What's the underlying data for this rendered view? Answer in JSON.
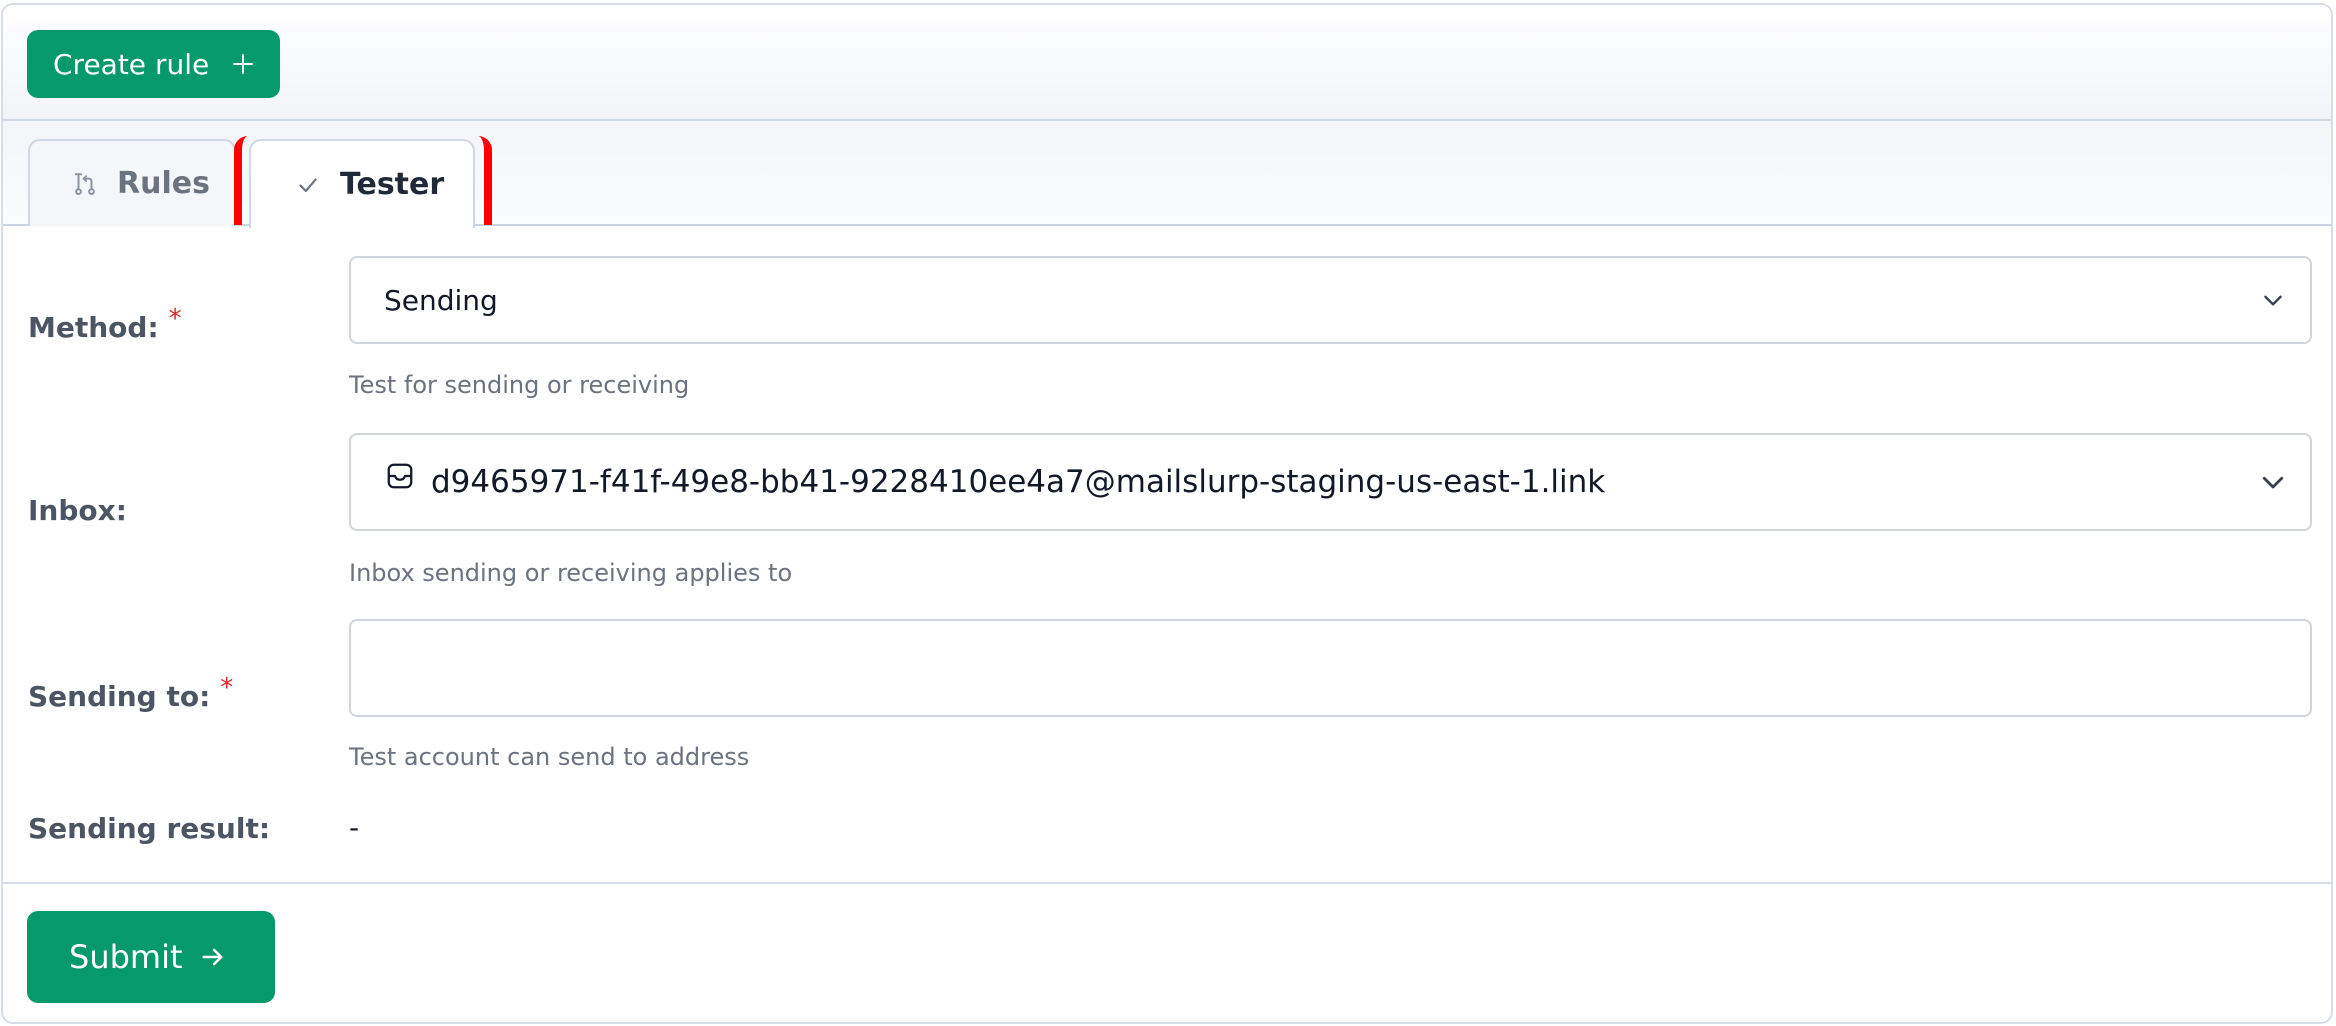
{
  "toolbar": {
    "create_label": "Create rule"
  },
  "tabs": [
    {
      "label": "Rules",
      "icon": "git-branch-icon",
      "active": false
    },
    {
      "label": "Tester",
      "icon": "check-icon",
      "active": true
    }
  ],
  "form": {
    "method": {
      "label": "Method:",
      "required_marker": "*",
      "value": "Sending",
      "help": "Test for sending or receiving"
    },
    "inbox": {
      "label": "Inbox:",
      "value": "d9465971-f41f-49e8-bb41-9228410ee4a7@mailslurp-staging-us-east-1.link",
      "icon": "inbox-icon",
      "help": "Inbox sending or receiving applies to"
    },
    "sending_to": {
      "label": "Sending to:",
      "required_marker": "*",
      "value": "",
      "help": "Test account can send to address"
    },
    "sending_result": {
      "label": "Sending result:",
      "value": "-"
    }
  },
  "footer": {
    "submit_label": "Submit"
  },
  "colors": {
    "accent": "#06996a",
    "required": "#dc2626",
    "highlight": "#ff0000"
  }
}
